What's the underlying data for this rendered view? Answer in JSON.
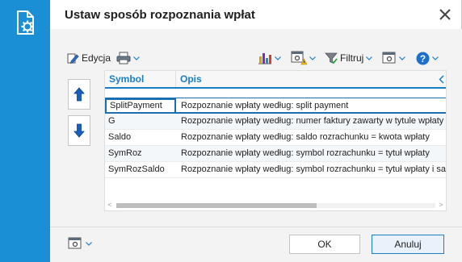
{
  "dialog": {
    "title": "Ustaw sposób rozpoznania wpłat"
  },
  "toolbar": {
    "edit_label": "Edycja",
    "filter_label": "Filtruj"
  },
  "grid": {
    "columns": [
      "Symbol",
      "Opis"
    ],
    "rows": [
      {
        "symbol": "SplitPayment",
        "opis": "Rozpoznanie wpłaty według: split payment"
      },
      {
        "symbol": "G",
        "opis": "Rozpoznanie wpłaty według: numer faktury zawarty w tytule wpłaty"
      },
      {
        "symbol": "Saldo",
        "opis": "Rozpoznanie wpłaty według: saldo rozrachunku = kwota wpłaty"
      },
      {
        "symbol": "SymRoz",
        "opis": "Rozpoznanie wpłaty według: symbol rozrachunku = tytuł wpłaty"
      },
      {
        "symbol": "SymRozSaldo",
        "opis": "Rozpoznanie wpłaty według: symbol rozrachunku = tytuł wpłaty i sa"
      }
    ],
    "selected_index": 0
  },
  "footer": {
    "ok_label": "OK",
    "cancel_label": "Anuluj"
  },
  "colors": {
    "accent": "#1a8fd6",
    "header_text": "#1a7ec6",
    "arrow_blue": "#1560c0"
  }
}
